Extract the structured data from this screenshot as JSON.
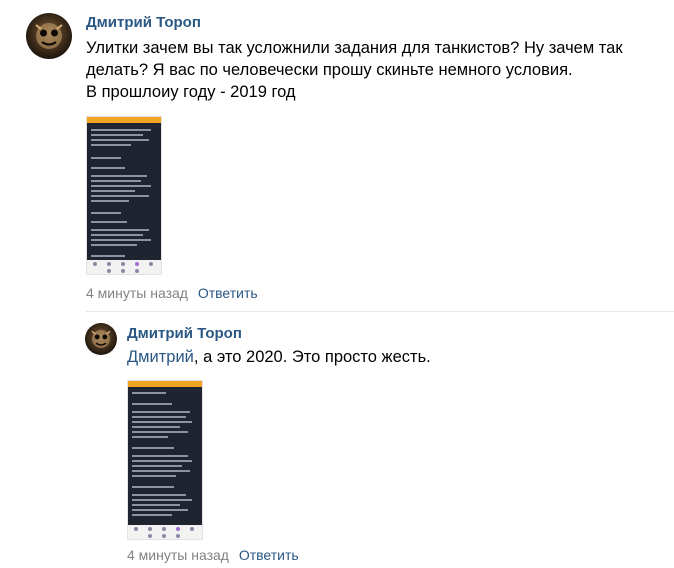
{
  "comments": [
    {
      "author": "Дмитрий Тороп",
      "text_lines": [
        "Улитки зачем вы так усложнили задания для танкистов? Ну зачем так",
        "делать? Я вас по человечески прошу скиньте немного условия.",
        "В прошлоиу году - 2019 год"
      ],
      "time": "4 минуты назад",
      "reply_label": "Ответить"
    },
    {
      "author": "Дмитрий Тороп",
      "mention": "Дмитрий",
      "text_rest": ", а это 2020. Это просто жесть.",
      "time": "4 минуты назад",
      "reply_label": "Ответить"
    }
  ],
  "colors": {
    "link": "#2a5885",
    "meta": "#828282",
    "screenshot_bg": "#1f2430",
    "screenshot_status": "#f3a322"
  }
}
